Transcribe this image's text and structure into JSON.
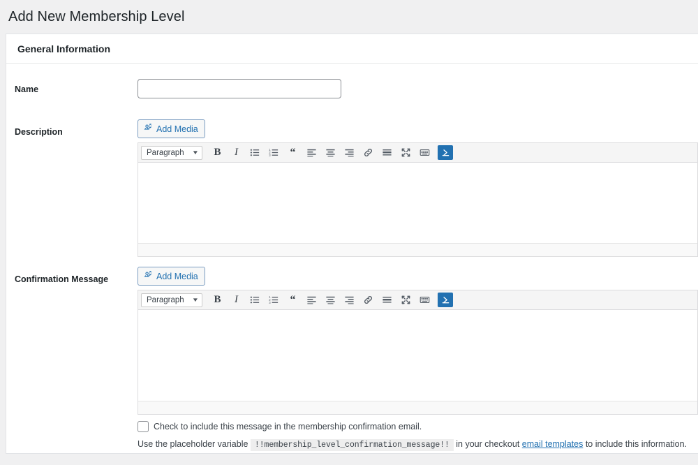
{
  "page": {
    "title": "Add New Membership Level"
  },
  "panel": {
    "heading": "General Information"
  },
  "fields": {
    "name": {
      "label": "Name",
      "value": "",
      "placeholder": ""
    },
    "description": {
      "label": "Description",
      "add_media_label": "Add Media",
      "content": ""
    },
    "confirmation": {
      "label": "Confirmation Message",
      "add_media_label": "Add Media",
      "content": "",
      "checkbox_label": "Check to include this message in the membership confirmation email.",
      "hint_prefix": "Use the placeholder variable",
      "hint_variable": "!!membership_level_confirmation_message!!",
      "hint_middle": "in your checkout",
      "hint_link": "email templates",
      "hint_suffix": "to include this information."
    }
  },
  "editor_toolbar": {
    "format_select": {
      "value": "Paragraph",
      "caret": "▼"
    },
    "buttons": [
      {
        "name": "bold-icon",
        "label": "B"
      },
      {
        "name": "italic-icon",
        "label": "I"
      },
      {
        "name": "bulleted-list-icon",
        "label": ""
      },
      {
        "name": "numbered-list-icon",
        "label": ""
      },
      {
        "name": "blockquote-icon",
        "label": "“"
      },
      {
        "name": "align-left-icon",
        "label": ""
      },
      {
        "name": "align-center-icon",
        "label": ""
      },
      {
        "name": "align-right-icon",
        "label": ""
      },
      {
        "name": "link-icon",
        "label": ""
      },
      {
        "name": "read-more-icon",
        "label": ""
      },
      {
        "name": "fullscreen-icon",
        "label": ""
      },
      {
        "name": "keyboard-shortcuts-icon",
        "label": ""
      },
      {
        "name": "toolbar-toggle-icon",
        "label": ""
      }
    ]
  },
  "colors": {
    "page_background": "#f0f0f1",
    "card_background": "#ffffff",
    "accent_blue": "#2271b1",
    "text": "#3c434a",
    "toolbar_background": "#f5f5f5",
    "border": "#dcdcde"
  }
}
